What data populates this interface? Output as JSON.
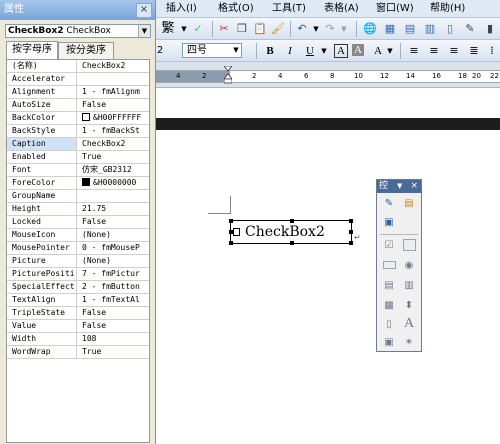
{
  "properties_panel": {
    "title": "属性",
    "close": "×",
    "object_name": "CheckBox2",
    "object_type": "CheckBox",
    "tabs": [
      "按字母序",
      "按分类序"
    ],
    "rows": [
      {
        "name": "(名称)",
        "value": "CheckBox2"
      },
      {
        "name": "Accelerator",
        "value": ""
      },
      {
        "name": "Alignment",
        "value": "1 - fmAlignm"
      },
      {
        "name": "AutoSize",
        "value": "False"
      },
      {
        "name": "BackColor",
        "value": "&H00FFFFFF"
      },
      {
        "name": "BackStyle",
        "value": "1 - fmBackSt"
      },
      {
        "name": "Caption",
        "value": "CheckBox2"
      },
      {
        "name": "Enabled",
        "value": "True"
      },
      {
        "name": "Font",
        "value": "仿宋_GB2312"
      },
      {
        "name": "ForeColor",
        "value": "&H0000000"
      },
      {
        "name": "GroupName",
        "value": ""
      },
      {
        "name": "Height",
        "value": "21.75"
      },
      {
        "name": "Locked",
        "value": "False"
      },
      {
        "name": "MouseIcon",
        "value": "(None)"
      },
      {
        "name": "MousePointer",
        "value": "0 - fmMouseP"
      },
      {
        "name": "Picture",
        "value": "(None)"
      },
      {
        "name": "PicturePositi",
        "value": "7 - fmPictur"
      },
      {
        "name": "SpecialEffect",
        "value": "2 - fmButton"
      },
      {
        "name": "TextAlign",
        "value": "1 - fmTextAl"
      },
      {
        "name": "TripleState",
        "value": "False"
      },
      {
        "name": "Value",
        "value": "False"
      },
      {
        "name": "Width",
        "value": "108"
      },
      {
        "name": "WordWrap",
        "value": "True"
      }
    ],
    "selected_row": "Caption",
    "colors": {
      "backcolor_swatch": "#ffffff",
      "forecolor_swatch": "#000000",
      "selection": "#cfe2f8"
    }
  },
  "menubar": {
    "items": [
      "插入(I)",
      "格式(O)",
      "工具(T)",
      "表格(A)",
      "窗口(W)",
      "帮助(H)"
    ]
  },
  "toolbar": {
    "font_size": "四号",
    "left_fragment": "2",
    "fan_label": "繁"
  },
  "ruler": {
    "numbers": [
      "4",
      "2",
      "2",
      "4",
      "6",
      "8",
      "10",
      "12",
      "14",
      "16",
      "18",
      "20",
      "22"
    ]
  },
  "document": {
    "checkbox_caption": "CheckBox2"
  },
  "toolbox": {
    "title": "控",
    "close": "×",
    "icons": [
      "design-mode-icon",
      "properties-icon",
      "view-code-icon",
      "checkbox-icon",
      "textbox-icon",
      "command-button-icon",
      "option-button-icon",
      "listbox-icon",
      "combobox-icon",
      "toggle-button-icon",
      "spin-button-icon",
      "scrollbar-icon",
      "label-icon",
      "image-icon",
      "more-controls-icon"
    ]
  }
}
